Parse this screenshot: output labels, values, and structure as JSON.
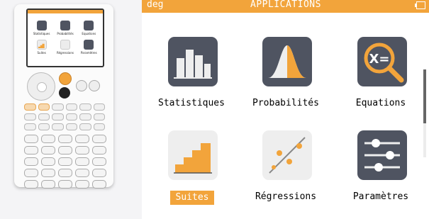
{
  "status_bar": {
    "angle_mode": "deg",
    "title": "APPLICATIONS"
  },
  "apps": [
    {
      "label": "Statistiques",
      "icon": "statistics-icon",
      "selected": false
    },
    {
      "label": "Probabilités",
      "icon": "probability-icon",
      "selected": false
    },
    {
      "label": "Equations",
      "icon": "equations-icon",
      "selected": false
    },
    {
      "label": "Suites",
      "icon": "sequences-icon",
      "selected": true
    },
    {
      "label": "Régressions",
      "icon": "regressions-icon",
      "selected": false
    },
    {
      "label": "Paramètres",
      "icon": "settings-icon",
      "selected": false
    }
  ],
  "colors": {
    "accent": "#f2a43b",
    "icon_dark": "#4f5461",
    "icon_light": "#eeeeee"
  }
}
